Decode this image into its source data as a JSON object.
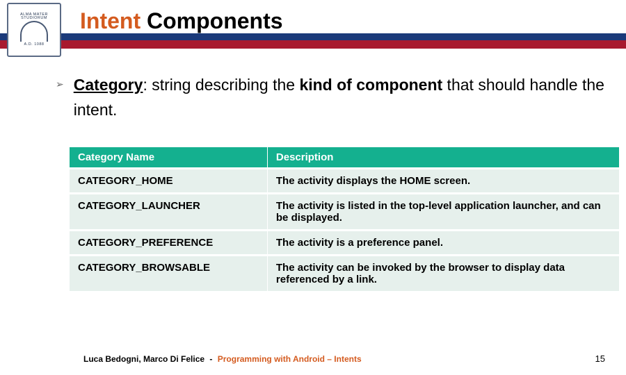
{
  "header": {
    "title_accent": "Intent",
    "title_rest": " Components",
    "logo_caption_top": "ALMA MATER STUDIORUM",
    "logo_caption_bottom": "A.D. 1088"
  },
  "bullet": {
    "category_label": "Category",
    "sep": ": string describing the ",
    "kind_label": "kind of component",
    "rest": " that should handle the intent."
  },
  "table": {
    "headers": {
      "name": "Category Name",
      "desc": "Description"
    },
    "rows": [
      {
        "name": "CATEGORY_HOME",
        "desc": "The activity displays the HOME screen."
      },
      {
        "name": "CATEGORY_LAUNCHER",
        "desc": "The activity is listed in the top-level application launcher, and can be displayed."
      },
      {
        "name": "CATEGORY_PREFERENCE",
        "desc": "The activity is a preference panel."
      },
      {
        "name": "CATEGORY_BROWSABLE",
        "desc": "The activity can be invoked by the browser to display data referenced by a link."
      }
    ]
  },
  "footer": {
    "authors": "Luca Bedogni, Marco Di Felice",
    "dash": "-",
    "course": "Programming with Android – Intents",
    "page": "15"
  }
}
